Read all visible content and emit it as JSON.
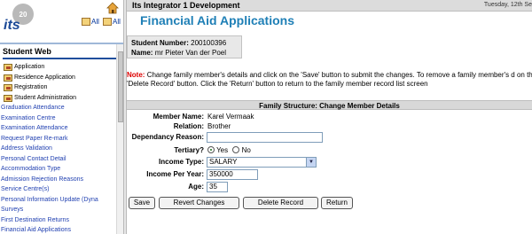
{
  "left": {
    "logo_text": "its",
    "logo_badge": "20",
    "quick_links": [
      {
        "label": "All"
      },
      {
        "label": "All"
      }
    ],
    "section_title": "Student Web",
    "menu": [
      {
        "label": "Application",
        "type": "top"
      },
      {
        "label": "Residence Application",
        "type": "top"
      },
      {
        "label": "Registration",
        "type": "top"
      },
      {
        "label": "Student Administration",
        "type": "top"
      },
      {
        "label": "Graduation Attendance",
        "type": "sub"
      },
      {
        "label": "Examination Centre",
        "type": "sub"
      },
      {
        "label": "Examination Attendance",
        "type": "sub"
      },
      {
        "label": "Request Paper Re-mark",
        "type": "sub"
      },
      {
        "label": "Address Validation",
        "type": "sub"
      },
      {
        "label": "Personal Contact Detail",
        "type": "sub"
      },
      {
        "label": "Accommodation Type",
        "type": "sub"
      },
      {
        "label": "Admission Rejection Reasons",
        "type": "sub"
      },
      {
        "label": "Service Centre(s)",
        "type": "sub"
      },
      {
        "label": "Personal Information Update (Dyna",
        "type": "sub"
      },
      {
        "label": "Surveys",
        "type": "sub"
      },
      {
        "label": "First Destination Returns",
        "type": "sub"
      },
      {
        "label": "Financial Aid Applications",
        "type": "sub"
      }
    ]
  },
  "header": {
    "app_title": "Its Integrator 1 Development",
    "date": "Tuesday, 12th Se",
    "page_title": "Financial Aid Applications"
  },
  "student": {
    "number_label": "Student Number:",
    "number": "200100396",
    "name_label": "Name:",
    "name": "mr Pieter Van der Poel"
  },
  "note": {
    "label": "Note:",
    "text": "Change family member's details and click on the 'Save' button to submit the changes. To remove a family member's d on the 'Delete Record' button. Click the 'Return' button to return to the family member record list screen"
  },
  "form": {
    "header": "Family Structure: Change Member Details",
    "member_name_label": "Member Name:",
    "member_name": "Karel Vermaak",
    "relation_label": "Relation:",
    "relation": "Brother",
    "dependancy_label": "Dependancy Reason:",
    "dependancy_value": "",
    "tertiary_label": "Tertiary?",
    "tertiary_yes": "Yes",
    "tertiary_no": "No",
    "tertiary_selected": "Yes",
    "income_type_label": "Income Type:",
    "income_type": "SALARY",
    "income_year_label": "Income Per Year:",
    "income_year": "350000",
    "age_label": "Age:",
    "age": "35"
  },
  "buttons": {
    "save": "Save",
    "revert": "Revert Changes",
    "delete": "Delete Record",
    "return": "Return"
  },
  "colors": {
    "page_title": "#1e7fb6",
    "menu_link": "#1f3fb0",
    "note_label": "#dd0000"
  }
}
